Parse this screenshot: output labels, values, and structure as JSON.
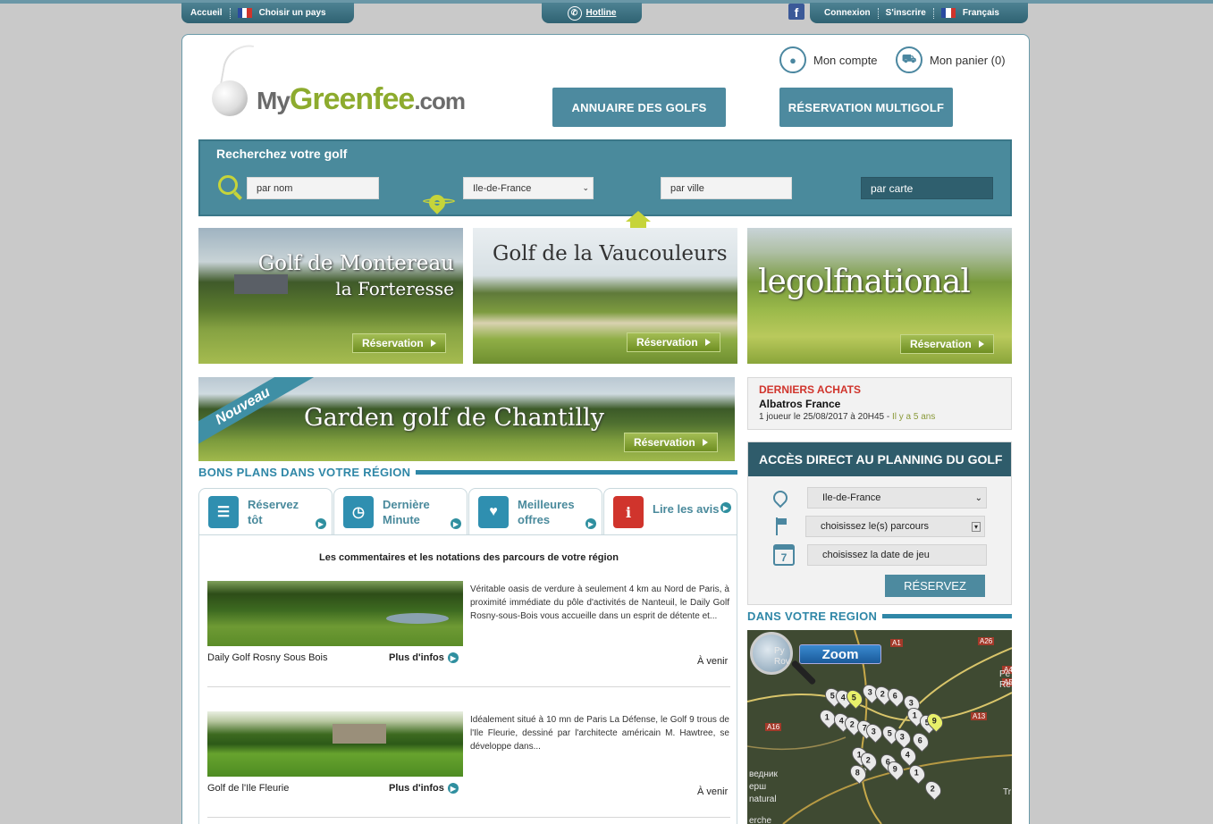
{
  "topbar": {
    "home": "Accueil",
    "choose_country": "Choisir un pays",
    "hotline": "Hotline",
    "login": "Connexion",
    "register": "S'inscrire",
    "language": "Français"
  },
  "header": {
    "logo_my": "My",
    "logo_greenfee": "Greenfee",
    "logo_com": ".com",
    "account": "Mon compte",
    "cart": "Mon panier (0)",
    "btn_directory": "ANNUAIRE DES GOLFS",
    "btn_multigolf": "RÉSERVATION MULTIGOLF"
  },
  "search": {
    "title": "Recherchez votre golf",
    "by_name": "par nom",
    "region": "Ile-de-France",
    "by_city": "par ville",
    "by_map": "par carte"
  },
  "banners": [
    {
      "title_1": "Golf de Montereau",
      "title_2": "la Forteresse",
      "button": "Réservation"
    },
    {
      "title_1": "Golf de la Vaucouleurs",
      "button": "Réservation"
    },
    {
      "title_1": "legolfnational",
      "button": "Réservation"
    },
    {
      "title_1": "Garden golf de Chantilly",
      "ribbon": "Nouveau",
      "button": "Réservation"
    }
  ],
  "last_purchases": {
    "heading": "DERNIERS ACHATS",
    "name": "Albatros France",
    "detail": "1 joueur le 25/08/2017 à 20H45 - ",
    "ago": "Il y a 5 ans"
  },
  "planning": {
    "heading": "ACCÈS DIRECT AU PLANNING DU GOLF",
    "region": "Ile-de-France",
    "courses": "choisissez le(s) parcours",
    "date": "choisissez la date de jeu",
    "calendar_day": "7",
    "button": "RÉSERVEZ"
  },
  "deals": {
    "heading": "BONS PLANS DANS VOTRE RÉGION",
    "tabs": [
      {
        "label_1": "Réservez",
        "label_2": "tôt"
      },
      {
        "label_1": "Dernière",
        "label_2": "Minute"
      },
      {
        "label_1": "Meilleures",
        "label_2": "offres"
      },
      {
        "label_1": "Lire les avis",
        "label_2": ""
      }
    ]
  },
  "reviews": {
    "intro": "Les commentaires et les notations des parcours de votre région",
    "items": [
      {
        "text": "Véritable oasis de verdure à seulement 4 km au Nord de Paris, à proximité immédiate du pôle d'activités de Nanteuil, le Daily Golf Rosny-sous-Bois vous accueille dans un esprit de détente et...",
        "name": "Daily Golf Rosny Sous Bois",
        "more": "Plus d'infos",
        "status": "À venir"
      },
      {
        "text": "Idéalement situé à 10 mn de Paris La Défense, le Golf 9 trous de l'Ile Fleurie, dessiné par l'architecte américain M. Hawtree, se développe dans...",
        "name": "Golf de l'Ile Fleurie",
        "more": "Plus d'infos",
        "status": "À venir"
      }
    ]
  },
  "region_map": {
    "heading": "DANS VOTRE REGION",
    "zoom": "Zoom",
    "pins": [
      "5",
      "4",
      "5",
      "3",
      "2",
      "6",
      "3",
      "1",
      "5",
      "1",
      "4",
      "2",
      "7",
      "3",
      "5",
      "3",
      "6",
      "9",
      "1",
      "2",
      "6",
      "4",
      "9",
      "1",
      "2",
      "8"
    ],
    "road_labels": [
      "A1",
      "A26",
      "A16",
      "A13",
      "A4",
      "A5"
    ],
    "place_labels": [
      "Py",
      "Rov",
      "Pe",
      "Re",
      "Ve",
      "Tr",
      "ведник",
      "ерш",
      "natural",
      "erche"
    ]
  },
  "colors": {
    "teal": "#4d8a9f",
    "dark_teal": "#2f5c6b",
    "section_blue": "#2f87a7",
    "lime": "#c6d43a",
    "logo_green": "#8dab2e",
    "red": "#d0342c"
  }
}
